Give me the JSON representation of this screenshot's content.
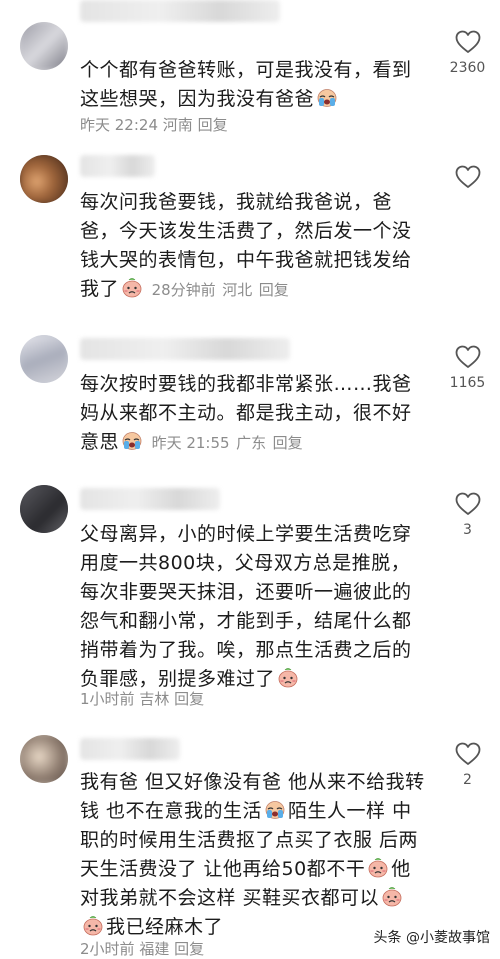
{
  "comments": [
    {
      "text": "个个都有爸爸转账，可是我没有，看到这些想哭，因为我没有爸爸",
      "time": "昨天 22:24",
      "location": "河南",
      "reply": "回复",
      "likes": "2360"
    },
    {
      "text": "每次问我爸要钱，我就给我爸说，爸爸，今天该发生活费了，然后发一个没钱大哭的表情包，中午我爸就把钱发给我了",
      "time": "28分钟前",
      "location": "河北",
      "reply": "回复",
      "likes": ""
    },
    {
      "text": "每次按时要钱的我都非常紧张……我爸妈从来都不主动。都是我主动，很不好意思",
      "time": "昨天 21:55",
      "location": "广东",
      "reply": "回复",
      "likes": "1165"
    },
    {
      "text": "父母离异，小的时候上学要生活费吃穿用度一共800块，父母双方总是推脱，每次非要哭天抹泪，还要听一遍彼此的怨气和翻小常，才能到手，结尾什么都捎带着为了我。唉，那点生活费之后的负罪感，别提多难过了",
      "time": "1小时前",
      "location": "吉林",
      "reply": "回复",
      "likes": "3"
    },
    {
      "text_parts": [
        "我有爸 但又好像没有爸 他从来不给我转钱 也不在意我的生活",
        "陌生人一样 中职的时候用生活费抠了点买了衣服 后两天生活费没了 让他再给50都不干",
        "他对我弟就不会这样 买鞋买衣都可以",
        "我已经麻木了"
      ],
      "time": "2小时前",
      "location": "福建",
      "reply": "回复",
      "likes": "2"
    }
  ],
  "watermark": "头条 @小菱故事馆",
  "icons": {
    "like": "heart-outline-icon",
    "crying": "crying-emoji-icon",
    "sad": "sad-face-emoji-icon"
  },
  "colors": {
    "text": "#1c1c1c",
    "meta": "#8c8c8c",
    "heart": "#555555"
  }
}
